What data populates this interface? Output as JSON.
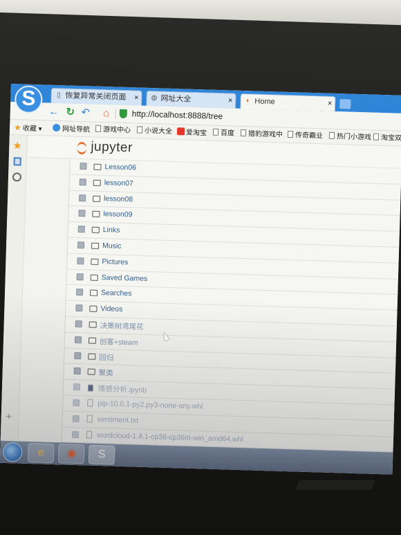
{
  "browser": {
    "tabs": [
      {
        "label": "恢复异常关闭页面",
        "icon": "page-icon",
        "active": false
      },
      {
        "label": "网址大全",
        "icon": "globe-icon",
        "active": false
      },
      {
        "label": "Home",
        "icon": "jupyter-icon",
        "active": true
      }
    ],
    "close_symbol": "×",
    "url": "http://localhost:8888/tree",
    "favorites": [
      {
        "label": "收藏",
        "icon": "star-icon"
      },
      {
        "label": "网址导航",
        "icon": "globe-icon"
      },
      {
        "label": "游戏中心",
        "icon": "page-icon"
      },
      {
        "label": "小说大全",
        "icon": "page-icon"
      },
      {
        "label": "爱淘宝",
        "icon": "taobao-icon"
      },
      {
        "label": "百度",
        "icon": "page-icon"
      },
      {
        "label": "猎豹游戏中",
        "icon": "page-icon"
      },
      {
        "label": "传奇霸业",
        "icon": "page-icon"
      },
      {
        "label": "热门小游戏",
        "icon": "page-icon"
      },
      {
        "label": "淘宝双",
        "icon": "page-icon"
      }
    ]
  },
  "jupyter": {
    "logo_text": "jupyter",
    "files": [
      {
        "name": "Lesson06",
        "type": "folder"
      },
      {
        "name": "lesson07",
        "type": "folder"
      },
      {
        "name": "lesson08",
        "type": "folder"
      },
      {
        "name": "lesson09",
        "type": "folder"
      },
      {
        "name": "Links",
        "type": "folder"
      },
      {
        "name": "Music",
        "type": "folder"
      },
      {
        "name": "Pictures",
        "type": "folder"
      },
      {
        "name": "Saved Games",
        "type": "folder"
      },
      {
        "name": "Searches",
        "type": "folder"
      },
      {
        "name": "Videos",
        "type": "folder"
      },
      {
        "name": "决策树鸢尾花",
        "type": "folder"
      },
      {
        "name": "创客+steam",
        "type": "folder"
      },
      {
        "name": "回归",
        "type": "folder"
      },
      {
        "name": "聚类",
        "type": "folder"
      },
      {
        "name": "情感分析.ipynb",
        "type": "notebook"
      },
      {
        "name": "pip-10.0.1-py2.py3-none-any.whl",
        "type": "file"
      },
      {
        "name": "sentiment.txt",
        "type": "file"
      },
      {
        "name": "wordcloud-1.4.1-cp36-cp36m-win_amd64.whl",
        "type": "file"
      }
    ]
  },
  "taskbar": {
    "start_icon": "windows-start-icon",
    "apps": [
      "ie-icon",
      "media-player-icon",
      "sogou-browser-icon"
    ]
  }
}
